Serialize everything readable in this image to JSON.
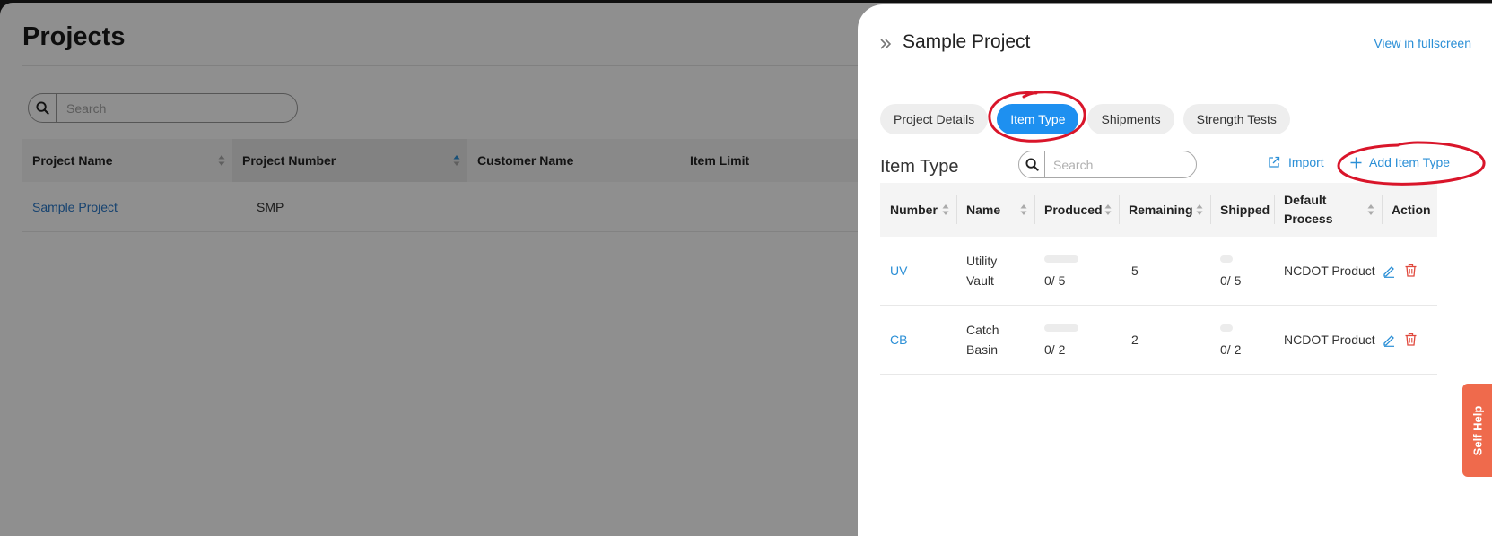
{
  "background": {
    "title": "Projects",
    "search_placeholder": "Search",
    "columns": [
      "Project Name",
      "Project Number",
      "Customer Name",
      "Item Limit"
    ],
    "rows": [
      {
        "project_name": "Sample Project",
        "project_number": "SMP",
        "customer_name": "",
        "item_limit": ""
      }
    ]
  },
  "drawer": {
    "title": "Sample Project",
    "fullscreen_link": "View in fullscreen",
    "tabs": [
      {
        "label": "Project Details",
        "active": false
      },
      {
        "label": "Item Type",
        "active": true
      },
      {
        "label": "Shipments",
        "active": false
      },
      {
        "label": "Strength Tests",
        "active": false
      }
    ],
    "section_title": "Item Type",
    "search_placeholder": "Search",
    "import_label": "Import",
    "add_label": "Add Item Type",
    "columns": {
      "number": "Number",
      "name": "Name",
      "produced": "Produced",
      "remaining": "Remaining",
      "shipped": "Shipped",
      "default_process_line1": "Default",
      "default_process_line2": "Process",
      "action": "Action"
    },
    "rows": [
      {
        "number": "UV",
        "name_line1": "Utility",
        "name_line2": "Vault",
        "produced": "0/ 5",
        "produced_fraction": 0,
        "remaining": "5",
        "shipped": "0/ 5",
        "shipped_fraction": 0,
        "default_process": "NCDOT Product"
      },
      {
        "number": "CB",
        "name_line1": "Catch",
        "name_line2": "Basin",
        "produced": "0/ 2",
        "produced_fraction": 0,
        "remaining": "2",
        "shipped": "0/ 2",
        "shipped_fraction": 0,
        "default_process": "NCDOT Product"
      }
    ]
  },
  "self_help_label": "Self Help",
  "colors": {
    "accent": "#1e90f0",
    "link": "#2b8fd6",
    "annotation": "#d9152a",
    "self_help": "#ef6a4c",
    "delete": "#e0483c"
  }
}
